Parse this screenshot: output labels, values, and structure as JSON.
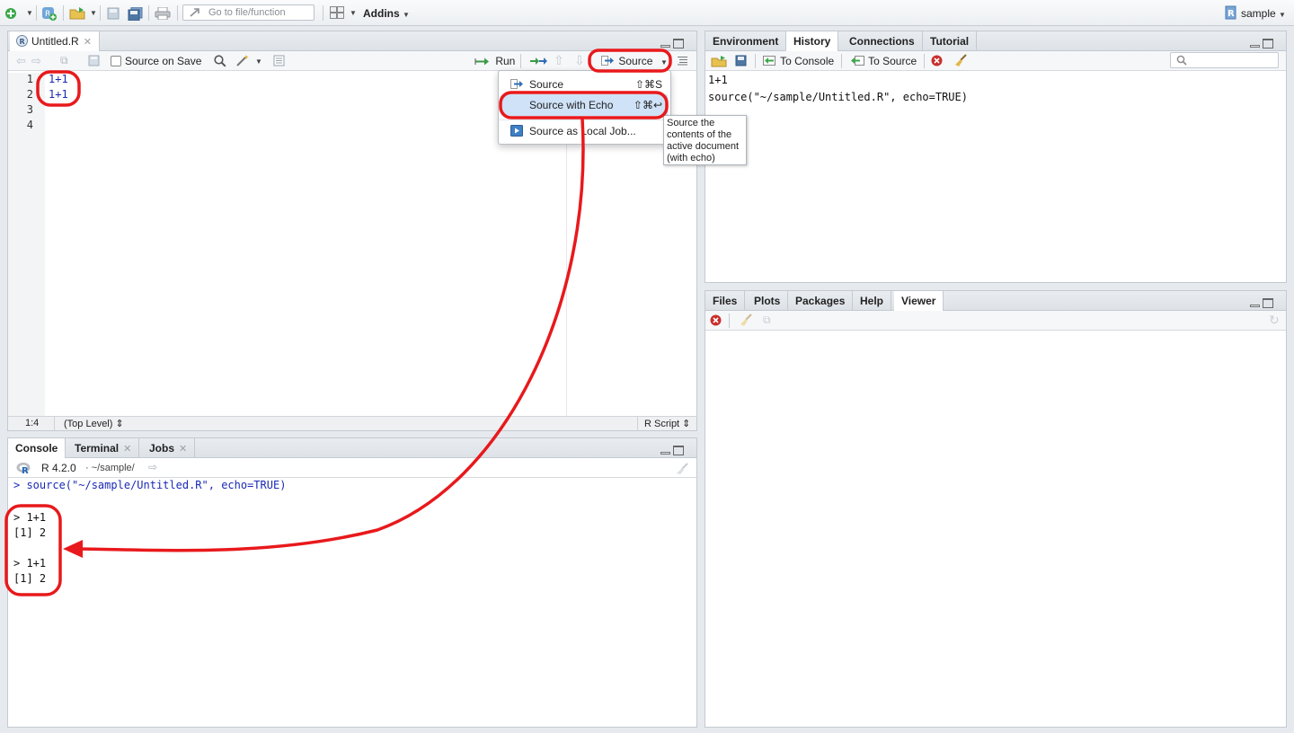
{
  "toolbar": {
    "goto_placeholder": "Go to file/function",
    "addins_label": "Addins",
    "project_label": "sample"
  },
  "editor": {
    "file_tab": "Untitled.R",
    "source_on_save": "Source on Save",
    "run_label": "Run",
    "source_label": "Source",
    "line_numbers": [
      "1",
      "2",
      "3",
      "4"
    ],
    "lines": [
      "1+1",
      "1+1",
      "",
      ""
    ],
    "status_position": "1:4",
    "status_scope": "(Top Level)",
    "status_type": "R Script"
  },
  "source_menu": {
    "items": [
      {
        "label": "Source",
        "shortcut": "⇧⌘S"
      },
      {
        "label": "Source with Echo",
        "shortcut": "⇧⌘↩"
      },
      {
        "label": "Source as Local Job...",
        "shortcut": ""
      }
    ],
    "tooltip": "Source the contents of the active document (with echo)"
  },
  "console": {
    "tabs": [
      "Console",
      "Terminal",
      "Jobs"
    ],
    "r_version": "R 4.2.0",
    "path": "· ~/sample/",
    "command": "> source(\"~/sample/Untitled.R\", echo=TRUE)",
    "output": [
      "> 1+1",
      "[1] 2",
      "",
      "> 1+1",
      "[1] 2"
    ]
  },
  "env_pane": {
    "tabs": [
      "Environment",
      "History",
      "Connections",
      "Tutorial"
    ],
    "active_tab": "History",
    "to_console": "To Console",
    "to_source": "To Source",
    "history": [
      "1+1",
      "source(\"~/sample/Untitled.R\", echo=TRUE)"
    ]
  },
  "files_pane": {
    "tabs": [
      "Files",
      "Plots",
      "Packages",
      "Help",
      "Viewer"
    ],
    "active_tab": "Viewer"
  },
  "colors": {
    "annotation": "#e8191c",
    "code_blue": "#1a29b5",
    "menu_highlight": "#cfe2f7"
  }
}
